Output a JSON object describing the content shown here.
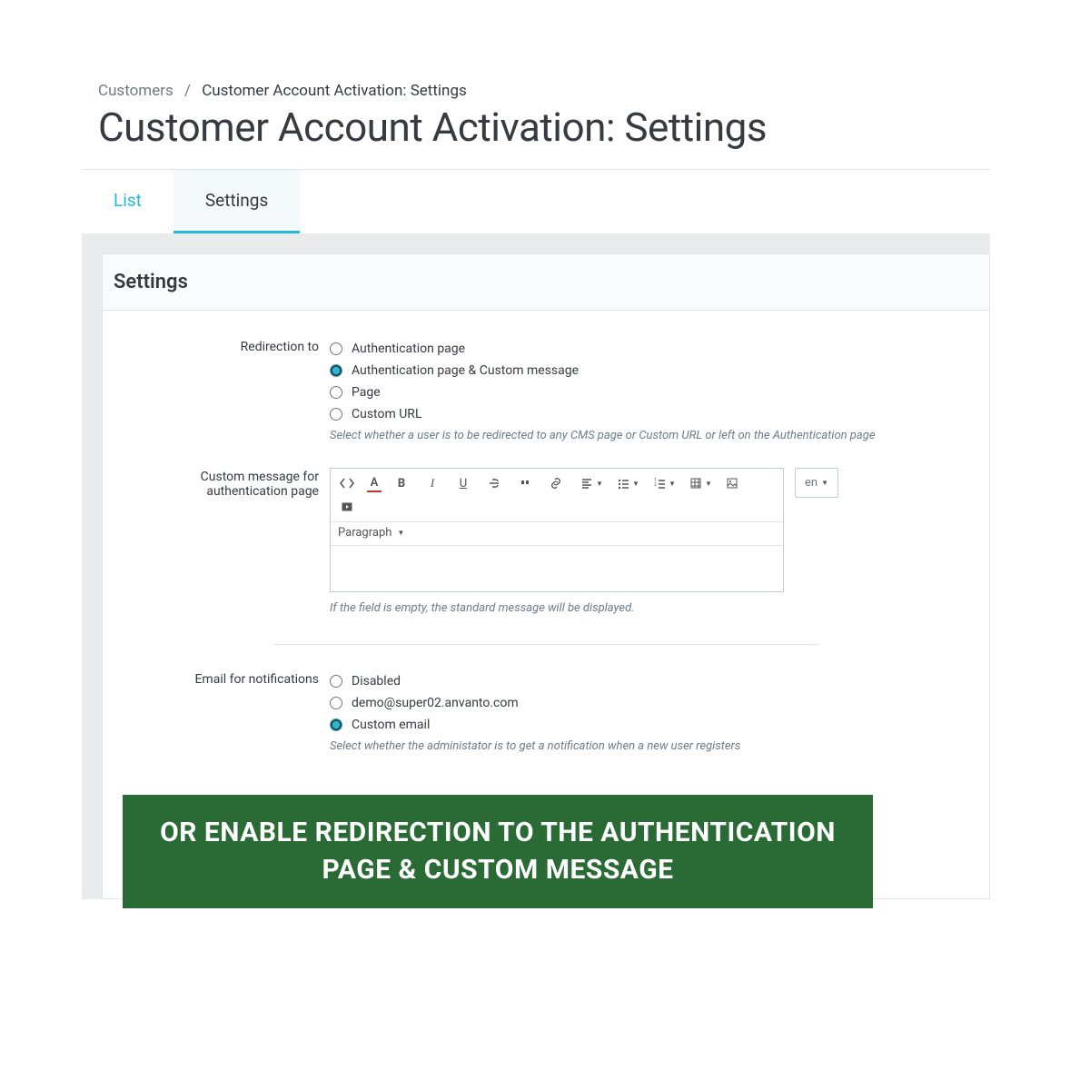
{
  "breadcrumb": {
    "parent": "Customers",
    "current": "Customer Account Activation: Settings"
  },
  "page_title": "Customer Account Activation: Settings",
  "tabs": {
    "list": "List",
    "settings": "Settings"
  },
  "panel": {
    "title": "Settings"
  },
  "redirection": {
    "label": "Redirection to",
    "options": {
      "auth": "Authentication page",
      "auth_custom": "Authentication page & Custom message",
      "page": "Page",
      "custom_url": "Custom URL"
    },
    "help": "Select whether a user is to be redirected to any CMS page or Custom URL or left on the Authentication page"
  },
  "custom_msg": {
    "label": "Custom message for authentication page",
    "paragraph": "Paragraph",
    "help": "If the field is empty, the standard message will be displayed.",
    "lang": "en"
  },
  "email": {
    "label": "Email for notifications",
    "options": {
      "disabled": "Disabled",
      "demo": "demo@super02.anvanto.com",
      "custom": "Custom email"
    },
    "help": "Select whether the administator is to get a notification when a new user registers"
  },
  "banner": {
    "text": "OR ENABLE REDIRECTION TO THE AUTHENTICATION PAGE & CUSTOM MESSAGE"
  }
}
